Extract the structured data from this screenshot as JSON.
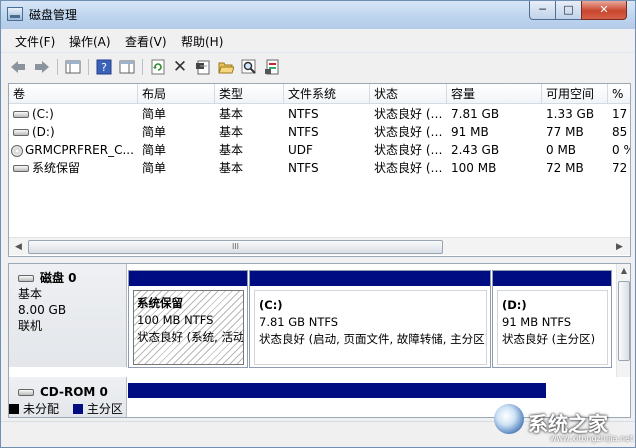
{
  "window": {
    "title": "磁盘管理",
    "min": "─",
    "max": "□",
    "close": "✕"
  },
  "menu": [
    "文件(F)",
    "操作(A)",
    "查看(V)",
    "帮助(H)"
  ],
  "toolbar": {
    "icons": [
      "back-arrow-icon",
      "forward-arrow-icon",
      "console-tree-icon",
      "help-icon",
      "properties-pane-icon",
      "refresh-icon",
      "delete-icon",
      "properties-icon",
      "open-folder-icon",
      "search-icon",
      "export-icon"
    ]
  },
  "table": {
    "headers": [
      "卷",
      "布局",
      "类型",
      "文件系统",
      "状态",
      "容量",
      "可用空间",
      "%"
    ],
    "rows": [
      [
        "(C:)",
        "简单",
        "基本",
        "NTFS",
        "状态良好 (…",
        "7.81 GB",
        "1.33 GB",
        "17"
      ],
      [
        "(D:)",
        "简单",
        "基本",
        "NTFS",
        "状态良好 (…",
        "91 MB",
        "77 MB",
        "85"
      ],
      [
        "GRMCPRFRER_C...",
        "简单",
        "基本",
        "UDF",
        "状态良好 (…",
        "2.43 GB",
        "0 MB",
        "0 %"
      ],
      [
        "系统保留",
        "简单",
        "基本",
        "NTFS",
        "状态良好 (…",
        "100 MB",
        "72 MB",
        "72"
      ]
    ],
    "scroll_grip": "III"
  },
  "disks": [
    {
      "name": "磁盘 0",
      "type": "基本",
      "size": "8.00 GB",
      "status": "联机",
      "partitions": [
        {
          "label": "系统保留",
          "size": "100 MB NTFS",
          "status": "状态良好 (系统, 活动, 主分区)"
        },
        {
          "label": "(C:)",
          "size": "7.81 GB NTFS",
          "status": "状态良好 (启动, 页面文件, 故障转储, 主分区)"
        },
        {
          "label": "(D:)",
          "size": "91 MB NTFS",
          "status": "状态良好 (主分区)"
        }
      ]
    },
    {
      "name": "CD-ROM 0"
    }
  ],
  "legend": [
    {
      "label": "未分配",
      "color": "#000000"
    },
    {
      "label": "主分区",
      "color": "#000c82"
    }
  ],
  "watermark": {
    "text": "系统之家",
    "url": "www.xitongzhijia.net"
  }
}
